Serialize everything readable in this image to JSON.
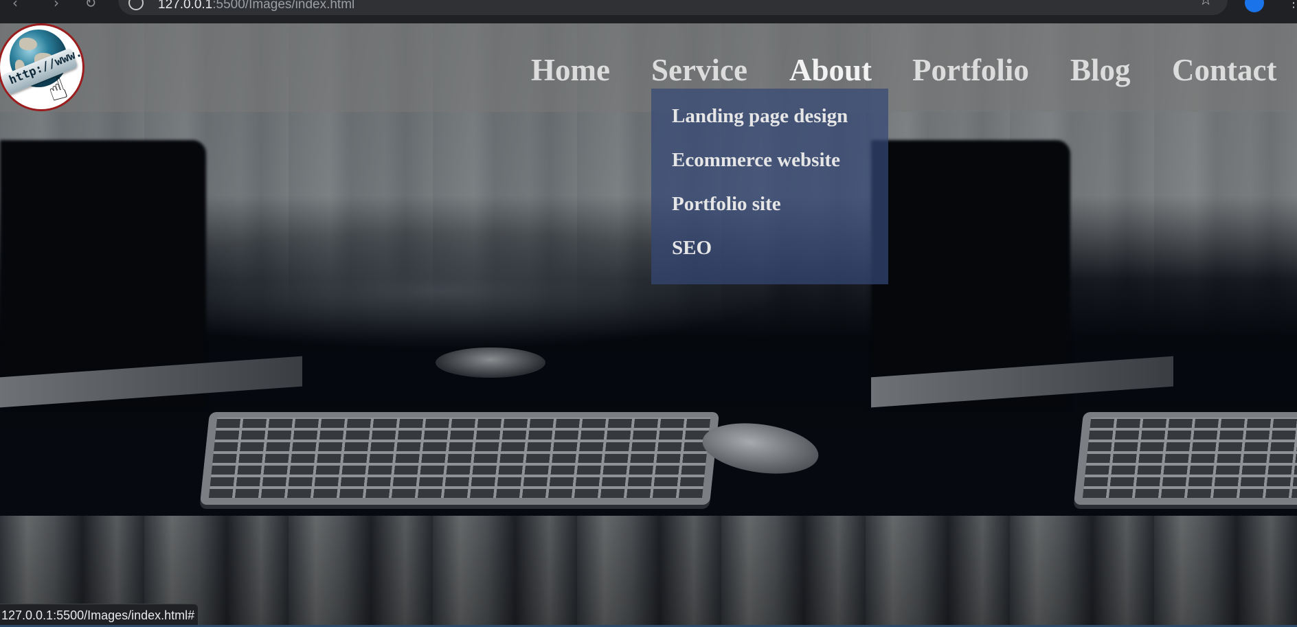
{
  "browser": {
    "url_host": "127.0.0.1",
    "url_rest": ":5500/Images/index.html",
    "status_url": "127.0.0.1:5500/Images/index.html#"
  },
  "logo": {
    "band_text": "http://www."
  },
  "nav": {
    "items": [
      {
        "label": "Home"
      },
      {
        "label": "Service"
      },
      {
        "label": "About"
      },
      {
        "label": "Portfolio"
      },
      {
        "label": "Blog"
      },
      {
        "label": "Contact"
      }
    ]
  },
  "dropdown": {
    "items": [
      {
        "label": "Landing page design"
      },
      {
        "label": "Ecommerce website"
      },
      {
        "label": "Portfolio site"
      },
      {
        "label": "SEO"
      }
    ]
  },
  "colors": {
    "header_overlay": "#787878",
    "dropdown_bg": "#344876",
    "nav_text": "#dcdcdc",
    "logo_border": "#9b1c1c"
  }
}
